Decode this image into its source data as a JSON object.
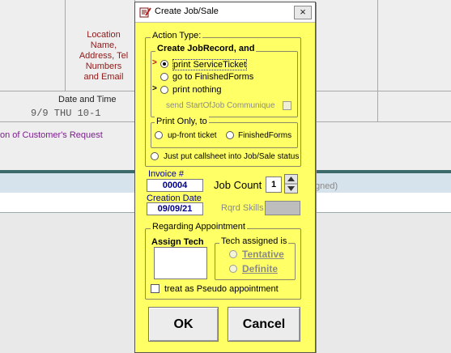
{
  "background": {
    "location_label": "Location Name, Address, Tel Numbers and Email",
    "date_time_label": "Date and Time",
    "date_value": "9/9 THU 10-1",
    "customer_request_label": "on of Customer's Request",
    "assigned_fragment": "gned)"
  },
  "dialog": {
    "title": "Create Job/Sale",
    "close_glyph": "×",
    "action_type": {
      "legend": "Action Type:",
      "create_legend": "Create JobRecord, and",
      "options": [
        {
          "label": "print ServiceTicket",
          "selected": true
        },
        {
          "label": "go to FinishedForms",
          "selected": false
        },
        {
          "label": "print nothing",
          "selected": false
        }
      ],
      "send_communique_label": "send StartOfJob Communique"
    },
    "print_only": {
      "legend": "Print Only, to",
      "options": [
        {
          "label": "up-front ticket",
          "selected": false
        },
        {
          "label": "FinishedForms",
          "selected": false
        }
      ]
    },
    "callsheet_label": "Just put callsheet into Job/Sale status",
    "invoice": {
      "label": "Invoice #",
      "value": "00004"
    },
    "job_count": {
      "label": "Job Count",
      "value": "1"
    },
    "creation_date": {
      "label": "Creation Date",
      "value": "09/09/21"
    },
    "rqrd_skills_label": "Rqrd Skills",
    "appointment": {
      "legend": "Regarding Appointment",
      "assign_tech_label": "Assign Tech",
      "tech_assigned_legend": "Tech assigned is",
      "tentative_label": "Tentative",
      "definite_label": "Definite",
      "pseudo_label": "treat as Pseudo appointment"
    },
    "ok_label": "OK",
    "cancel_label": "Cancel"
  }
}
